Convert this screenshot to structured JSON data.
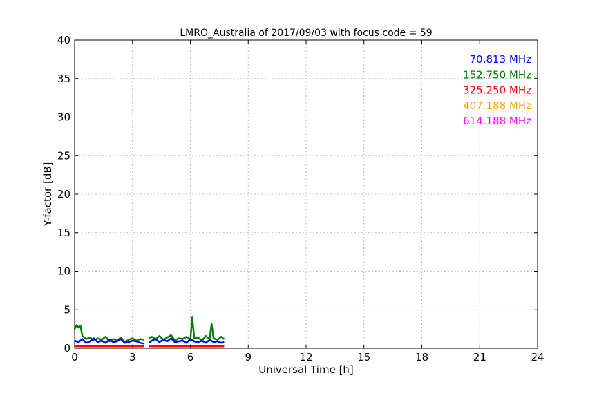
{
  "chart_data": {
    "type": "line",
    "title": "LMRO_Australia of 2017/09/03 with focus code = 59",
    "xlabel": "Universal Time [h]",
    "ylabel": "Y-factor [dB]",
    "xlim": [
      0,
      24
    ],
    "ylim": [
      0,
      40
    ],
    "xticks": [
      0,
      3,
      6,
      9,
      12,
      15,
      18,
      21,
      24
    ],
    "yticks": [
      0,
      5,
      10,
      15,
      20,
      25,
      30,
      35,
      40
    ],
    "xtick_labels": [
      "0",
      "3",
      "6",
      "9",
      "12",
      "15",
      "18",
      "21",
      "24"
    ],
    "ytick_labels": [
      "0",
      "5",
      "10",
      "15",
      "20",
      "25",
      "30",
      "35",
      "40"
    ],
    "grid": true,
    "legend_position": "top-right",
    "series": [
      {
        "name": "70.813 MHz",
        "color": "#0000ff",
        "x": [
          0.0,
          0.2,
          0.4,
          0.6,
          0.8,
          1.0,
          1.2,
          1.4,
          1.6,
          1.8,
          2.0,
          2.2,
          2.4,
          2.6,
          2.8,
          3.0,
          3.2,
          3.4,
          3.6,
          3.75,
          3.85,
          4.0,
          4.2,
          4.4,
          4.6,
          4.8,
          5.0,
          5.2,
          5.4,
          5.6,
          5.8,
          6.0,
          6.2,
          6.4,
          6.6,
          6.8,
          7.0,
          7.2,
          7.4,
          7.6,
          7.75
        ],
        "y": [
          1.0,
          0.8,
          1.2,
          0.7,
          0.9,
          1.3,
          0.8,
          1.0,
          0.7,
          1.1,
          0.8,
          0.9,
          1.2,
          0.7,
          0.8,
          1.0,
          0.9,
          0.7,
          0.6,
          null,
          0.7,
          1.0,
          1.2,
          0.8,
          1.1,
          0.9,
          1.3,
          0.8,
          0.9,
          1.0,
          0.7,
          1.2,
          0.9,
          0.8,
          1.0,
          0.7,
          1.1,
          0.8,
          0.9,
          0.7,
          0.8
        ]
      },
      {
        "name": "152.750 MHz",
        "color": "#008000",
        "x": [
          0.0,
          0.1,
          0.2,
          0.3,
          0.4,
          0.6,
          0.8,
          1.0,
          1.2,
          1.4,
          1.6,
          1.8,
          2.0,
          2.2,
          2.4,
          2.6,
          2.8,
          3.0,
          3.2,
          3.4,
          3.6,
          3.75,
          3.85,
          4.0,
          4.2,
          4.4,
          4.6,
          4.8,
          5.0,
          5.2,
          5.4,
          5.6,
          5.8,
          6.0,
          6.1,
          6.2,
          6.4,
          6.6,
          6.8,
          7.0,
          7.1,
          7.2,
          7.4,
          7.6,
          7.75
        ],
        "y": [
          2.5,
          3.0,
          2.7,
          2.9,
          1.6,
          1.2,
          1.4,
          1.0,
          1.3,
          1.1,
          1.5,
          0.9,
          1.2,
          1.0,
          1.4,
          0.8,
          1.1,
          1.3,
          1.0,
          1.2,
          1.1,
          null,
          1.3,
          1.5,
          1.2,
          1.6,
          1.1,
          1.4,
          1.7,
          1.0,
          1.3,
          1.2,
          1.5,
          1.1,
          4.0,
          1.3,
          1.4,
          1.0,
          1.6,
          1.2,
          3.2,
          1.3,
          1.1,
          1.5,
          1.2
        ]
      },
      {
        "name": "325.250 MHz",
        "color": "#ff0000",
        "x": [
          0.0,
          1.0,
          2.0,
          3.0,
          3.6,
          3.75,
          3.85,
          5.0,
          6.0,
          7.0,
          7.75
        ],
        "y": [
          0.3,
          0.3,
          0.3,
          0.3,
          0.3,
          null,
          0.3,
          0.3,
          0.3,
          0.3,
          0.3
        ]
      },
      {
        "name": "407.188 MHz",
        "color": "#ffa500",
        "x": [
          0.0,
          1.0,
          2.0,
          3.0,
          3.6,
          3.75,
          3.85,
          5.0,
          6.0,
          7.0,
          7.75
        ],
        "y": [
          0.2,
          0.2,
          0.2,
          0.2,
          0.2,
          null,
          0.2,
          0.2,
          0.2,
          0.2,
          0.2
        ]
      },
      {
        "name": "614.188 MHz",
        "color": "#ff00ff",
        "x": [
          0.0,
          1.0,
          2.0,
          3.0,
          3.6,
          3.75,
          3.85,
          5.0,
          6.0,
          7.0,
          7.75
        ],
        "y": [
          0.1,
          0.1,
          0.1,
          0.1,
          0.1,
          null,
          0.1,
          0.1,
          0.1,
          0.1,
          0.1
        ]
      }
    ]
  }
}
